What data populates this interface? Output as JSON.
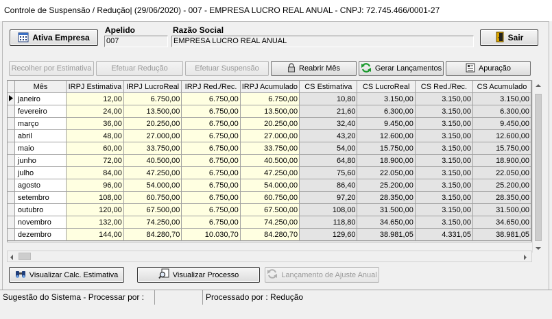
{
  "window": {
    "title": "Controle de Suspensão / Redução| (29/06/2020) - 007 - EMPRESA LUCRO REAL ANUAL  - CNPJ: 72.745.466/0001-27"
  },
  "header": {
    "ativa_label": "Ativa Empresa",
    "apelido_label": "Apelido",
    "apelido_value": "007",
    "razao_label": "Razão Social",
    "razao_value": "EMPRESA LUCRO REAL ANUAL",
    "sair_label": "Sair"
  },
  "toolbar": {
    "recolher": "Recolher por Estimativa",
    "efetuar_reducao": "Efetuar Redução",
    "efetuar_suspensao": "Efetuar Suspensão",
    "reabrir_mes": "Reabrir Mês",
    "gerar_lancamentos": "Gerar Lançamentos",
    "apuracao": "Apuração"
  },
  "grid": {
    "columns": [
      "Mês",
      "IRPJ Estimativa",
      "IRPJ LucroReal",
      "IRPJ Red./Rec.",
      "IRPJ Acumulado",
      "CS Estimativa",
      "CS LucroReal",
      "CS Red./Rec.",
      "CS Acumulado"
    ],
    "rows": [
      [
        "janeiro",
        "12,00",
        "6.750,00",
        "6.750,00",
        "6.750,00",
        "10,80",
        "3.150,00",
        "3.150,00",
        "3.150,00"
      ],
      [
        "fevereiro",
        "24,00",
        "13.500,00",
        "6.750,00",
        "13.500,00",
        "21,60",
        "6.300,00",
        "3.150,00",
        "6.300,00"
      ],
      [
        "março",
        "36,00",
        "20.250,00",
        "6.750,00",
        "20.250,00",
        "32,40",
        "9.450,00",
        "3.150,00",
        "9.450,00"
      ],
      [
        "abril",
        "48,00",
        "27.000,00",
        "6.750,00",
        "27.000,00",
        "43,20",
        "12.600,00",
        "3.150,00",
        "12.600,00"
      ],
      [
        "maio",
        "60,00",
        "33.750,00",
        "6.750,00",
        "33.750,00",
        "54,00",
        "15.750,00",
        "3.150,00",
        "15.750,00"
      ],
      [
        "junho",
        "72,00",
        "40.500,00",
        "6.750,00",
        "40.500,00",
        "64,80",
        "18.900,00",
        "3.150,00",
        "18.900,00"
      ],
      [
        "julho",
        "84,00",
        "47.250,00",
        "6.750,00",
        "47.250,00",
        "75,60",
        "22.050,00",
        "3.150,00",
        "22.050,00"
      ],
      [
        "agosto",
        "96,00",
        "54.000,00",
        "6.750,00",
        "54.000,00",
        "86,40",
        "25.200,00",
        "3.150,00",
        "25.200,00"
      ],
      [
        "setembro",
        "108,00",
        "60.750,00",
        "6.750,00",
        "60.750,00",
        "97,20",
        "28.350,00",
        "3.150,00",
        "28.350,00"
      ],
      [
        "outubro",
        "120,00",
        "67.500,00",
        "6.750,00",
        "67.500,00",
        "108,00",
        "31.500,00",
        "3.150,00",
        "31.500,00"
      ],
      [
        "novembro",
        "132,00",
        "74.250,00",
        "6.750,00",
        "74.250,00",
        "118,80",
        "34.650,00",
        "3.150,00",
        "34.650,00"
      ],
      [
        "dezembro",
        "144,00",
        "84.280,70",
        "10.030,70",
        "84.280,70",
        "129,60",
        "38.981,05",
        "4.331,05",
        "38.981,05"
      ]
    ]
  },
  "bottom": {
    "visualizar_calc": "Visualizar Calc. Estimativa",
    "visualizar_processo": "Visualizar Processo",
    "lancamento_ajuste": "Lançamento de Ajuste Anual"
  },
  "status": {
    "sugestao": "Sugestão do Sistema - Processar por :",
    "processado": "Processado por : Redução"
  },
  "colors": {
    "yellow_cell": "#ffffe1",
    "gray_cell": "#e4e4e4"
  }
}
